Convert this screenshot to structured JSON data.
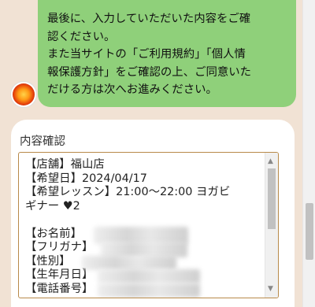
{
  "message": {
    "lines": [
      "最後に、入力していただいた内容をご確",
      "認ください。",
      "また当サイトの「ご利用規約」「個人情",
      "報保護方針」をご確認の上、ご同意いた",
      "だける方は次へお進みください。"
    ]
  },
  "confirm": {
    "title": "内容確認",
    "lines": [
      "【店舗】福山店",
      "【希望日】2024/04/17",
      "【希望レッスン】21:00～22:00 ヨガビ",
      "ギナー ♥2",
      "",
      "【お名前】",
      "【フリガナ】",
      "【性別】",
      "【生年月日】",
      "【電話番号】"
    ]
  },
  "icons": {
    "avatar": "flame-avatar-icon",
    "scroll_up": "▲",
    "scroll_down": "▼"
  },
  "colors": {
    "background": "#f1e2d4",
    "bubble": "#8fd07a",
    "box_border": "#b88a4a"
  }
}
